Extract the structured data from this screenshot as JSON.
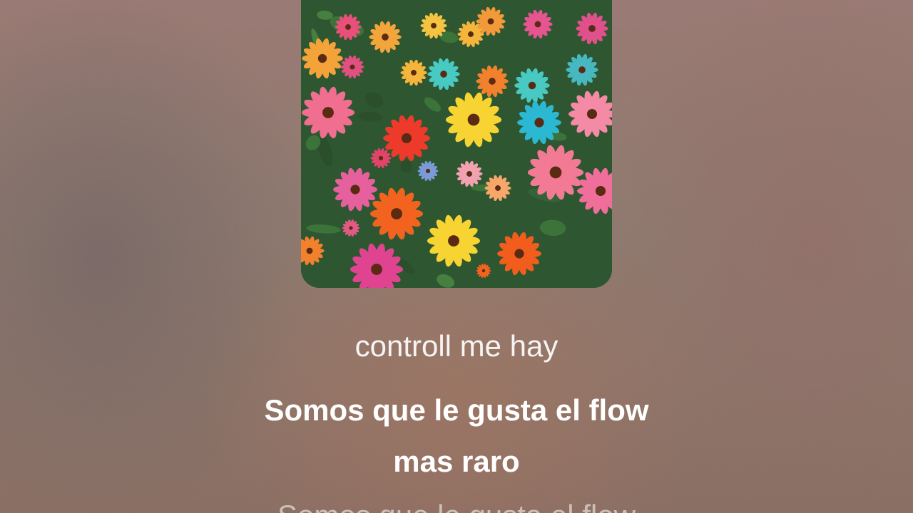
{
  "player": {
    "artwork": {
      "icon": "flower-field-artwork"
    },
    "lyrics": {
      "previous_line": "controll me hay",
      "current_line_1": "Somos que le gusta el flow",
      "current_line_2": "mas raro",
      "next_line": "Somos que le gusta el flow"
    }
  }
}
